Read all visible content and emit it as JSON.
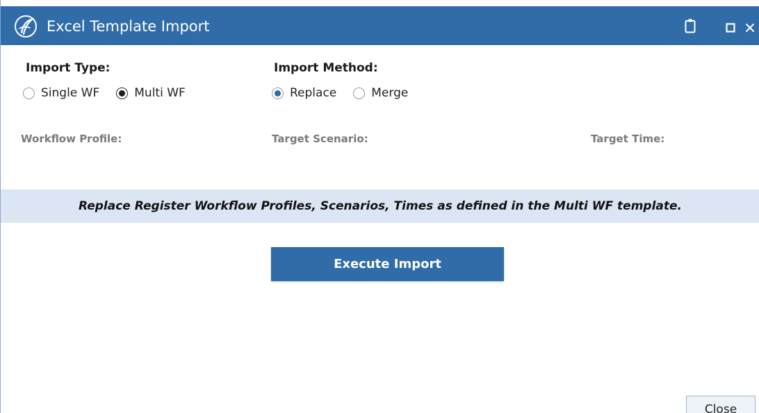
{
  "window": {
    "title": "Excel Template Import",
    "accent_color": "#2f6ca8",
    "band_color": "#dbe5f3"
  },
  "import_type": {
    "label": "Import Type:",
    "options": [
      "Single WF",
      "Multi WF"
    ],
    "selected": "Multi WF"
  },
  "import_method": {
    "label": "Import Method:",
    "options": [
      "Replace",
      "Merge"
    ],
    "selected": "Replace"
  },
  "fields": {
    "workflow_profile": "Workflow Profile:",
    "target_scenario": "Target Scenario:",
    "target_time": "Target Time:"
  },
  "info_message": "Replace Register Workflow Profiles, Scenarios, Times as defined in the Multi WF template.",
  "buttons": {
    "execute": "Execute Import",
    "close": "Close"
  },
  "icons": {
    "app_logo": "app-logo-icon",
    "clipboard": "clipboard-icon",
    "maximize": "maximize-icon",
    "close": "close-icon"
  }
}
